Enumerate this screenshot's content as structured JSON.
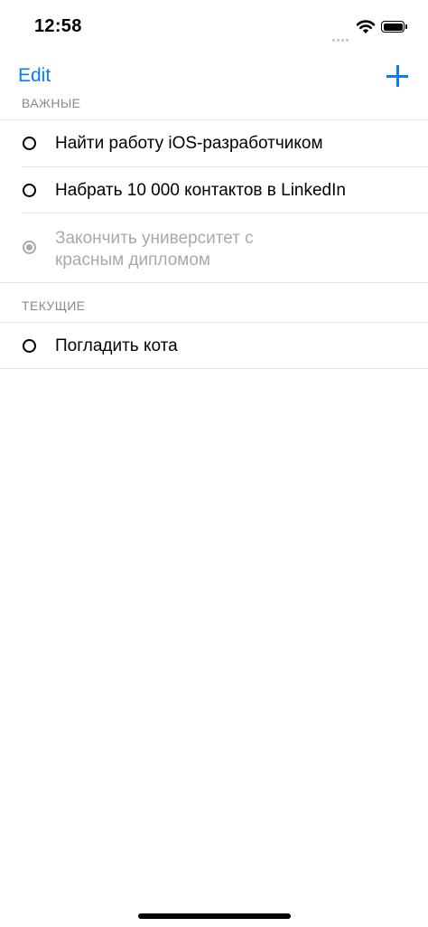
{
  "status": {
    "time": "12:58"
  },
  "nav": {
    "edit_label": "Edit",
    "add_icon": "plus-icon"
  },
  "sections": [
    {
      "header": "ВАЖНЫЕ",
      "items": [
        {
          "title": "Найти работу iOS-разработчиком",
          "completed": false
        },
        {
          "title": "Набрать 10 000 контактов в LinkedIn",
          "completed": false
        },
        {
          "title_line1": "Закончить университет с",
          "title_line2": "красным дипломом",
          "completed": true
        }
      ]
    },
    {
      "header": "ТЕКУЩИЕ",
      "items": [
        {
          "title": "Погладить кота",
          "completed": false
        }
      ]
    }
  ],
  "colors": {
    "accent": "#0a7aff",
    "completed_text": "#a9a9ad",
    "section_header": "#8a8a8e"
  }
}
